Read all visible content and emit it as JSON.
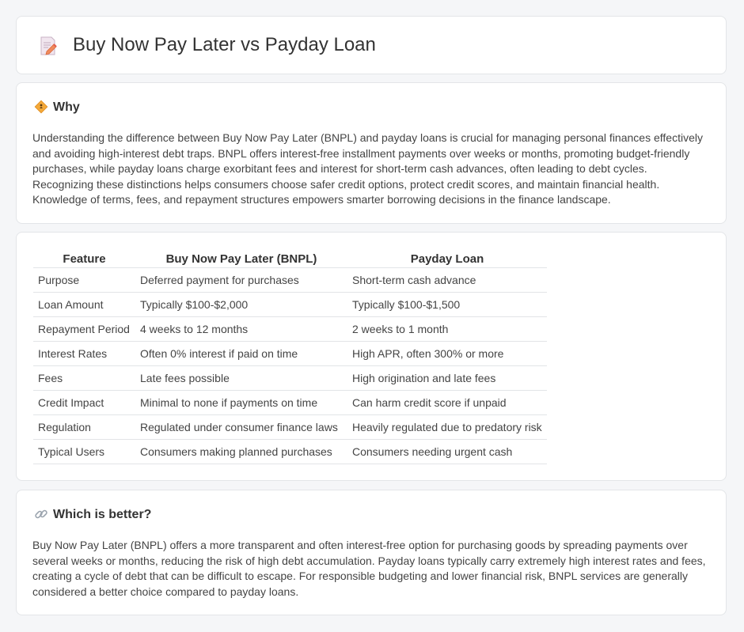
{
  "header": {
    "title": "Buy Now Pay Later vs Payday Loan",
    "icon": "document-pencil-icon"
  },
  "why": {
    "title": "Why",
    "icon": "warning-sign-icon",
    "text": "Understanding the difference between Buy Now Pay Later (BNPL) and payday loans is crucial for managing personal finances effectively and avoiding high-interest debt traps. BNPL offers interest-free installment payments over weeks or months, promoting budget-friendly purchases, while payday loans charge exorbitant fees and interest for short-term cash advances, often leading to debt cycles. Recognizing these distinctions helps consumers choose safer credit options, protect credit scores, and maintain financial health. Knowledge of terms, fees, and repayment structures empowers smarter borrowing decisions in the finance landscape."
  },
  "table": {
    "headers": [
      "Feature",
      "Buy Now Pay Later (BNPL)",
      "Payday Loan"
    ],
    "rows": [
      [
        "Purpose",
        "Deferred payment for purchases",
        "Short-term cash advance"
      ],
      [
        "Loan Amount",
        "Typically $100-$2,000",
        "Typically $100-$1,500"
      ],
      [
        "Repayment Period",
        "4 weeks to 12 months",
        "2 weeks to 1 month"
      ],
      [
        "Interest Rates",
        "Often 0% interest if paid on time",
        "High APR, often 300% or more"
      ],
      [
        "Fees",
        "Late fees possible",
        "High origination and late fees"
      ],
      [
        "Credit Impact",
        "Minimal to none if payments on time",
        "Can harm credit score if unpaid"
      ],
      [
        "Regulation",
        "Regulated under consumer finance laws",
        "Heavily regulated due to predatory risk"
      ],
      [
        "Typical Users",
        "Consumers making planned purchases",
        "Consumers needing urgent cash"
      ]
    ]
  },
  "better": {
    "title": "Which is better?",
    "icon": "link-icon",
    "text": "Buy Now Pay Later (BNPL) offers a more transparent and often interest-free option for purchasing goods by spreading payments over several weeks or months, reducing the risk of high debt accumulation. Payday loans typically carry extremely high interest rates and fees, creating a cycle of debt that can be difficult to escape. For responsible budgeting and lower financial risk, BNPL services are generally considered a better choice compared to payday loans."
  }
}
